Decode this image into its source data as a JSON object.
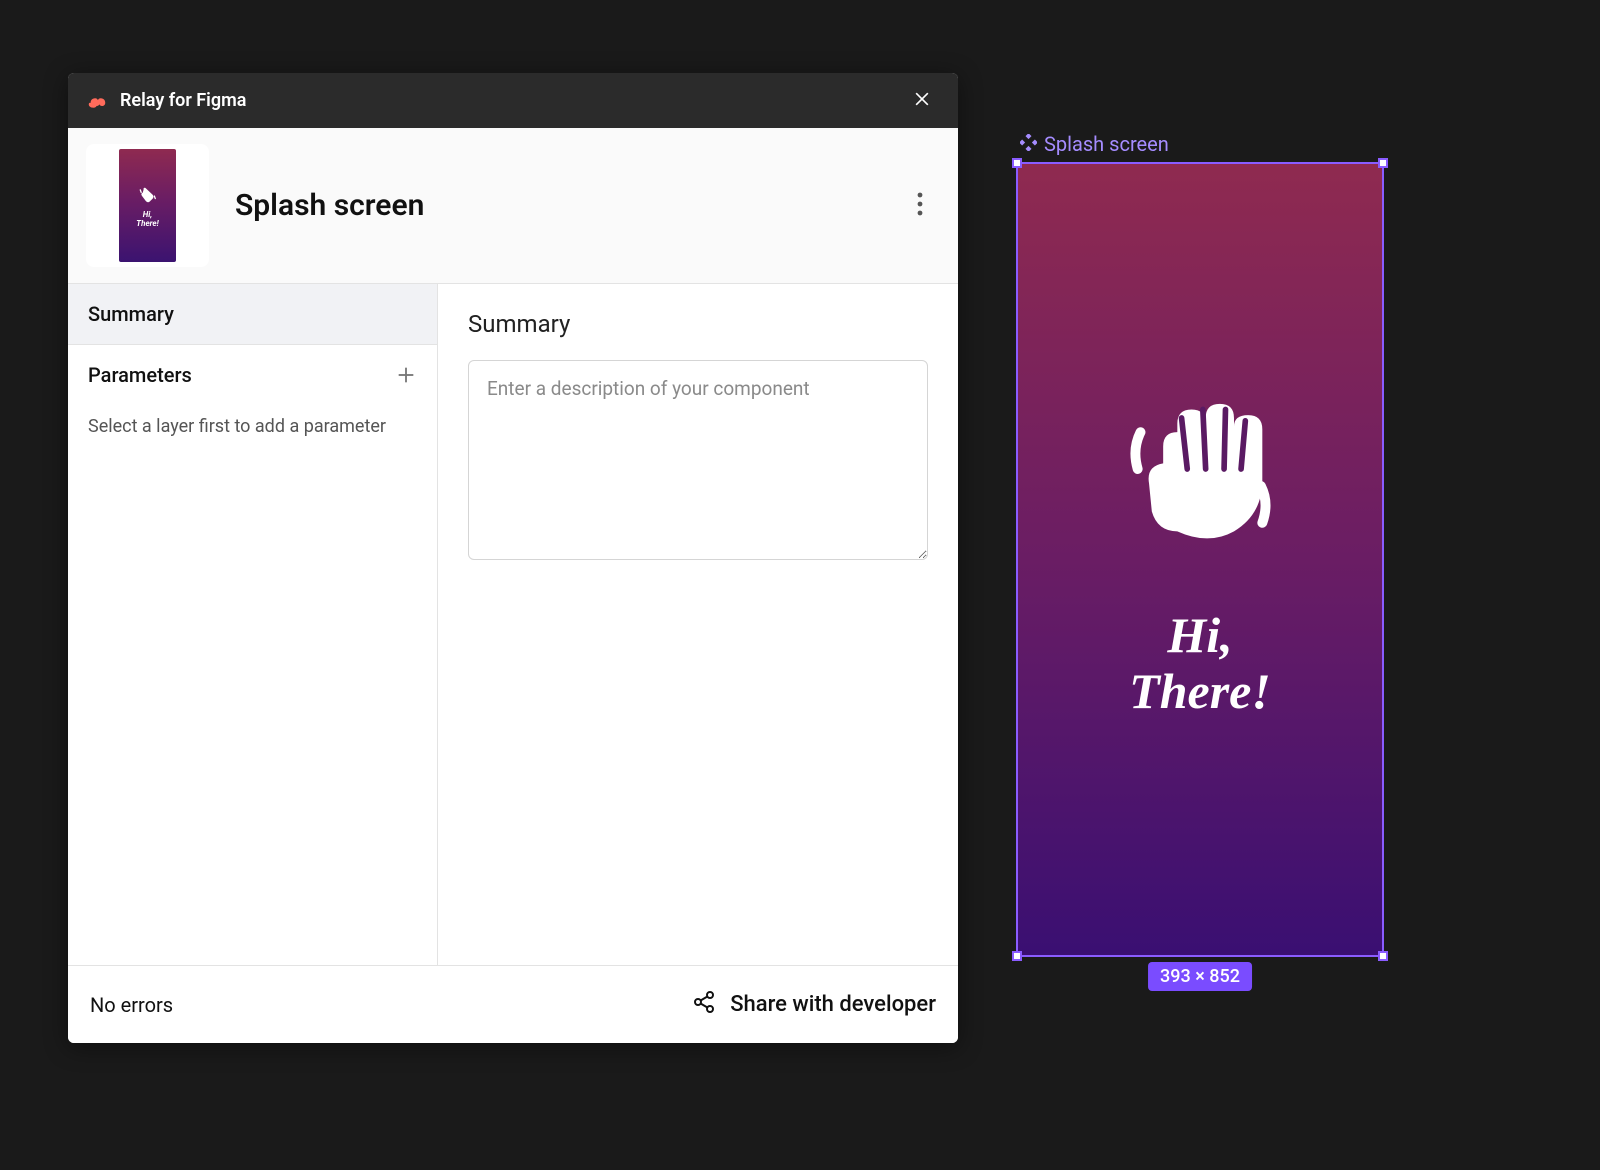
{
  "plugin": {
    "title": "Relay for Figma"
  },
  "header": {
    "component_name": "Splash screen",
    "thumb_line1": "Hi,",
    "thumb_line2": "There!"
  },
  "sidebar": {
    "summary_label": "Summary",
    "parameters_label": "Parameters",
    "parameters_help": "Select a layer first to add a parameter"
  },
  "content": {
    "heading": "Summary",
    "description_placeholder": "Enter a description of your component",
    "description_value": ""
  },
  "footer": {
    "status": "No errors",
    "share_label": "Share with developer"
  },
  "canvas": {
    "frame_label": "Splash screen",
    "greeting_line1": "Hi,",
    "greeting_line2": "There!",
    "dimensions": "393 × 852"
  },
  "colors": {
    "selection": "#8a5cff",
    "gradient_from": "#8f2a50",
    "gradient_mid": "#6a1d64",
    "gradient_to": "#3a0f72"
  }
}
